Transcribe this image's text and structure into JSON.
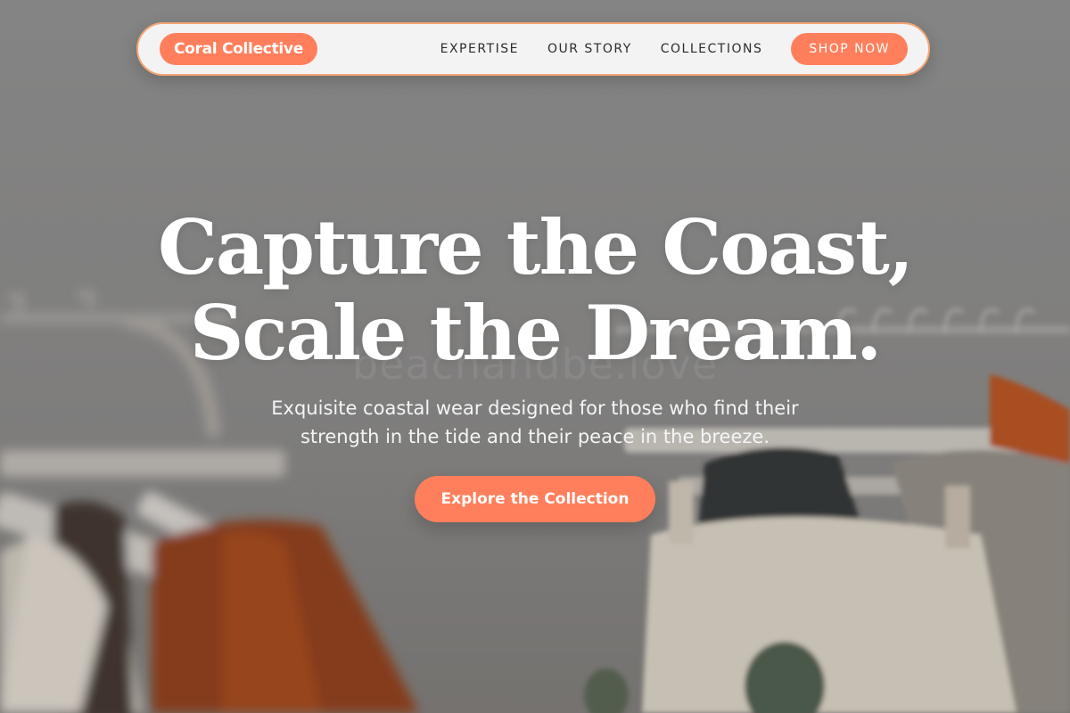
{
  "nav": {
    "brand": "Coral Collective",
    "links": [
      "EXPERTISE",
      "OUR STORY",
      "COLLECTIONS"
    ],
    "cta": "SHOP NOW"
  },
  "hero": {
    "headline_line1": "Capture the Coast,",
    "headline_line2": "Scale the Dream.",
    "subtitle": "Exquisite coastal wear designed for those who find their strength in the tide and their peace in the breeze.",
    "cta": "Explore the Collection",
    "watermark": "beachandbe.love",
    "background_image": "clothing-rack-photo"
  },
  "colors": {
    "accent": "#ff7f5c",
    "nav_border": "#f4a574",
    "nav_bg": "#f3f3f3",
    "text_light": "#ffffff"
  }
}
